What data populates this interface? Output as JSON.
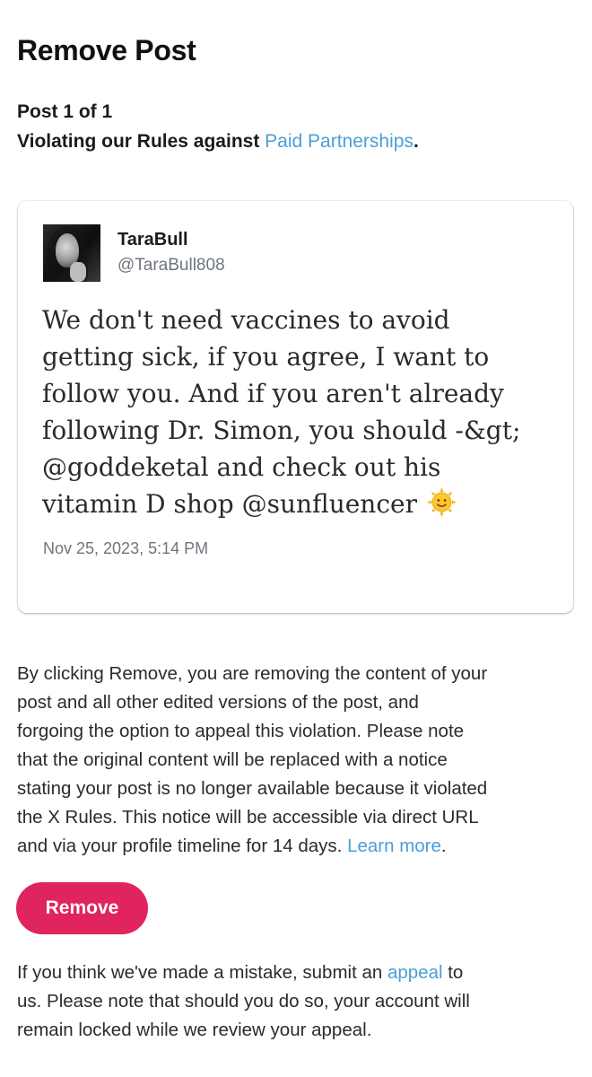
{
  "header": {
    "title": "Remove Post",
    "post_count": "Post 1 of 1",
    "violation_prefix": "Violating our Rules against ",
    "violation_link": "Paid Partnerships",
    "violation_suffix": "."
  },
  "post": {
    "display_name": "TaraBull",
    "handle": "@TaraBull808",
    "text": "We don't need vaccines to avoid\ngetting sick, if you agree, I want to\nfollow you. And if you aren't already\nfollowing Dr. Simon, you should -&gt;\n@goddeketal and check out his\nvitamin D shop @sunfluencer ",
    "emoji": "sun-with-face-icon",
    "timestamp": "Nov 25, 2023, 5:14 PM"
  },
  "disclaimer": {
    "text": "By clicking Remove, you are removing the content of your\npost and all other edited versions of the post, and\nforgoing the option to appeal this violation. Please note\nthat the original content will be replaced with a notice\nstating your post is no longer available because it violated\nthe X Rules. This notice will be accessible via direct URL\nand via your profile timeline for 14 days. ",
    "link": "Learn more",
    "suffix": "."
  },
  "actions": {
    "remove_label": "Remove"
  },
  "appeal": {
    "prefix": "If you think we've made a mistake, submit an ",
    "link": "appeal",
    "suffix": " to\nus. Please note that should you do so, your account will\nremain locked while we review your appeal."
  },
  "colors": {
    "link": "#4a9fd8",
    "remove_button": "#e0245e",
    "secondary_text": "#6e767d"
  }
}
